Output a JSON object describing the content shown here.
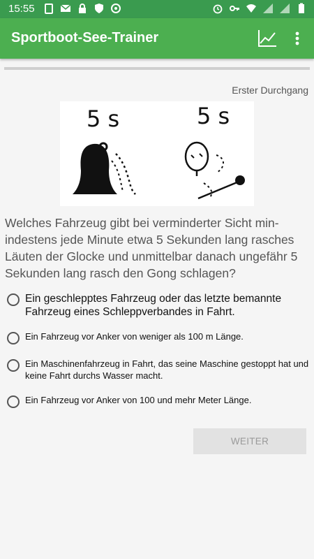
{
  "status_bar": {
    "time": "15:55",
    "left_icons": [
      "clipboard-icon",
      "mail-icon",
      "lock-icon",
      "shield-icon",
      "sync-icon"
    ],
    "right_icons": [
      "alarm-icon",
      "key-icon",
      "wifi-icon",
      "signal-icon",
      "signal-icon",
      "battery-icon"
    ]
  },
  "app_bar": {
    "title": "Sportboot-See-Trainer",
    "actions": [
      "chart-icon",
      "more-vert-icon"
    ],
    "color": "#4caf50"
  },
  "quiz": {
    "pass_label": "Erster Durchgang",
    "illustration": {
      "left_label": "5 s",
      "right_label": "5 s",
      "left_icon": "bell-icon",
      "right_icon": "gong-icon"
    },
    "question": "Welches Fahrzeug gibt bei verminderter Sicht min­indestens jede Minute etwa 5 Sekunden lang rasches Läuten der Glocke und unmittelbar danach ungefähr 5 Sekunden lang rasch den Gong schlagen?",
    "options": [
      "Ein geschlepptes Fahrzeug oder das letzte bemannte Fahrzeug eines Schleppverbandes in Fahrt.",
      "Ein Fahrzeug vor Anker von weniger als 100 m Länge.",
      "Ein Maschinenfahrzeug in Fahrt, das seine Maschine gestoppt hat und keine Fahrt durchs Wasser macht.",
      "Ein Fahrzeug vor Anker von 100 und mehr Meter Länge."
    ],
    "next_button": "WEITER"
  }
}
